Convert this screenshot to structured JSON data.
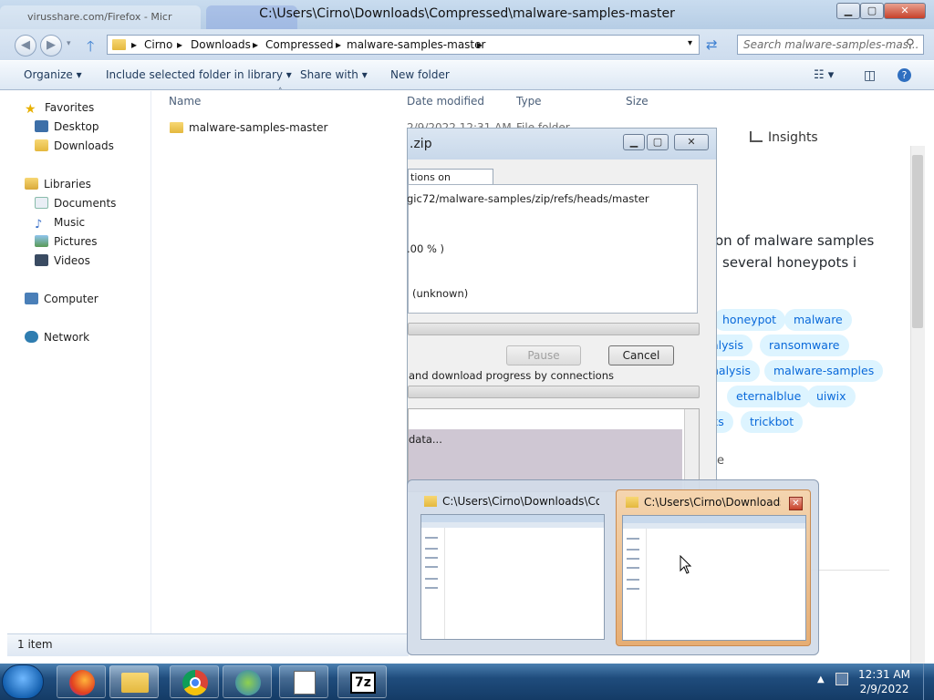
{
  "window": {
    "title": "C:\\Users\\Cirno\\Downloads\\Compressed\\malware-samples-master",
    "bg_tab": "virusshare.com/Firefox - Micr"
  },
  "address": {
    "crumbs": [
      "Cirno",
      "Downloads",
      "Compressed",
      "malware-samples-master"
    ],
    "search_placeholder": "Search malware-samples-mas..."
  },
  "toolbar": {
    "organize": "Organize ▾",
    "include": "Include selected folder in library ▾",
    "share": "Share with ▾",
    "new_folder": "New folder"
  },
  "sidebar": {
    "favorites": "Favorites",
    "desktop": "Desktop",
    "downloads": "Downloads",
    "libraries": "Libraries",
    "documents": "Documents",
    "music": "Music",
    "pictures": "Pictures",
    "videos": "Videos",
    "computer": "Computer",
    "network": "Network"
  },
  "columns": {
    "name": "Name",
    "date": "Date modified",
    "type": "Type",
    "size": "Size"
  },
  "files": [
    {
      "name": "malware-samples-master",
      "date": "2/9/2022 12:31 AM",
      "type": "File folder"
    }
  ],
  "status": {
    "count": "1 item"
  },
  "download_dialog": {
    "title": ".zip",
    "tab": "tions on completion",
    "url": "gic72/malware-samples/zip/refs/heads/master",
    "percent": ".00 % )",
    "remaining": "(unknown)",
    "pause": "Pause",
    "cancel": "Cancel",
    "connections": "and download progress by connections",
    "list_text": "data..."
  },
  "background_page": {
    "insights": "Insights",
    "desc_line1": "on of malware samples",
    "desc_line2": "several honeypots i",
    "tags": [
      "honeypot",
      "malware",
      "alysis",
      "ransomware",
      "nalysis",
      "malware-samples",
      "eternalblue",
      "uiwix",
      "ks",
      "trickbot"
    ],
    "fragment": "e"
  },
  "preview": {
    "card1_title": "C:\\Users\\Cirno\\Downloads\\Co...",
    "card2_title": "C:\\Users\\Cirno\\Downloads\\...",
    "close": "✕"
  },
  "taskbar": {
    "time": "12:31 AM",
    "date": "2/9/2022"
  }
}
